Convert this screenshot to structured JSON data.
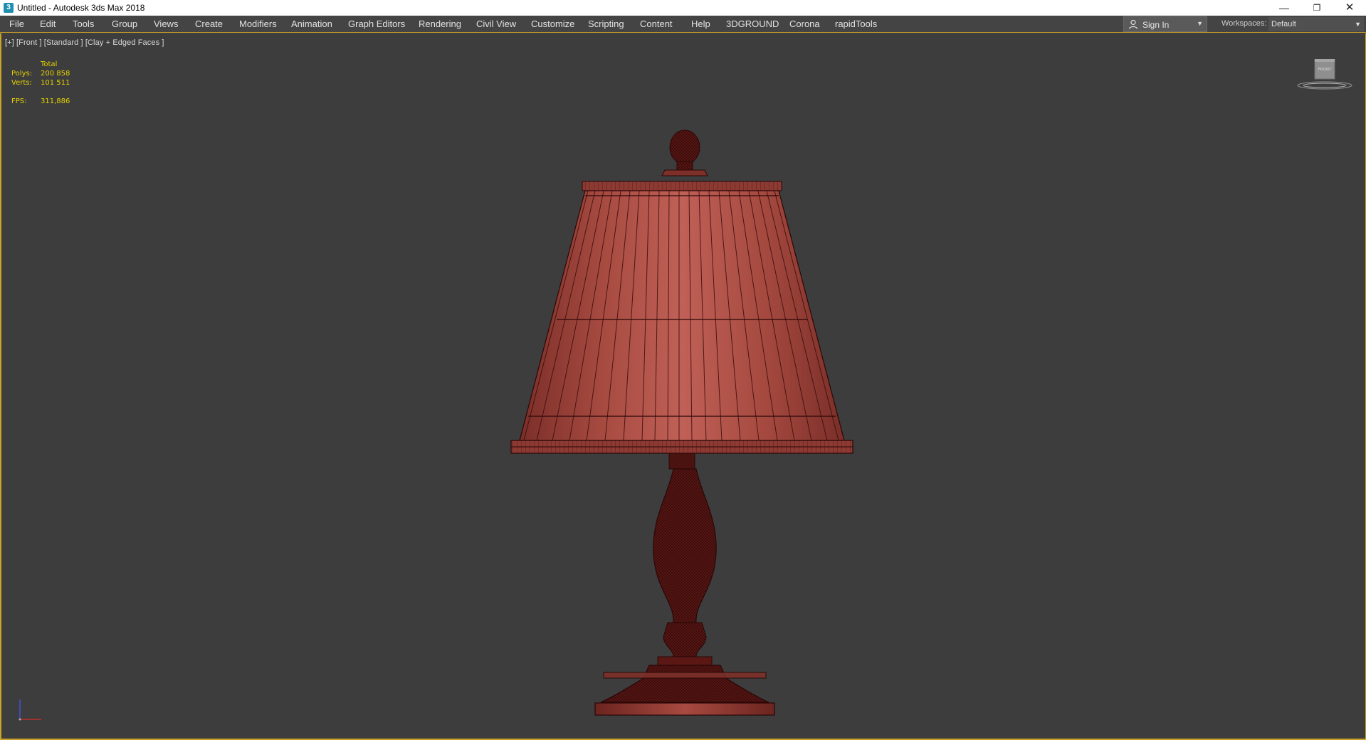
{
  "window": {
    "title": "Untitled - Autodesk 3ds Max 2018",
    "app_icon_glyph": "3",
    "minimize_glyph": "—",
    "restore_glyph": "❐",
    "close_glyph": "✕"
  },
  "menu": [
    {
      "label": "File"
    },
    {
      "label": "Edit"
    },
    {
      "label": "Tools"
    },
    {
      "label": "Group"
    },
    {
      "label": "Views"
    },
    {
      "label": "Create"
    },
    {
      "label": "Modifiers"
    },
    {
      "label": "Animation"
    },
    {
      "label": "Graph Editors"
    },
    {
      "label": "Rendering"
    },
    {
      "label": "Civil View"
    },
    {
      "label": "Customize"
    },
    {
      "label": "Scripting"
    },
    {
      "label": "Content"
    },
    {
      "label": "Help"
    },
    {
      "label": "3DGROUND"
    },
    {
      "label": "Corona"
    },
    {
      "label": "rapidTools"
    }
  ],
  "account": {
    "sign_in_label": "Sign In",
    "icon": "user-icon"
  },
  "workspaces": {
    "label": "Workspaces:",
    "selected": "Default"
  },
  "viewport": {
    "label": "[+] [Front ] [Standard ] [Clay + Edged Faces ]",
    "stats": {
      "header": "Total",
      "polys_label": "Polys:",
      "polys_value": "200 858",
      "verts_label": "Verts:",
      "verts_value": "101 511",
      "fps_label": "FPS:",
      "fps_value": "311,886"
    },
    "viewcube_face": "FRONT"
  },
  "colors": {
    "accent_border": "#c9a227",
    "stats_text": "#e6d200",
    "model_clay": "#a84a40",
    "model_edge": "#3a0c0c"
  }
}
